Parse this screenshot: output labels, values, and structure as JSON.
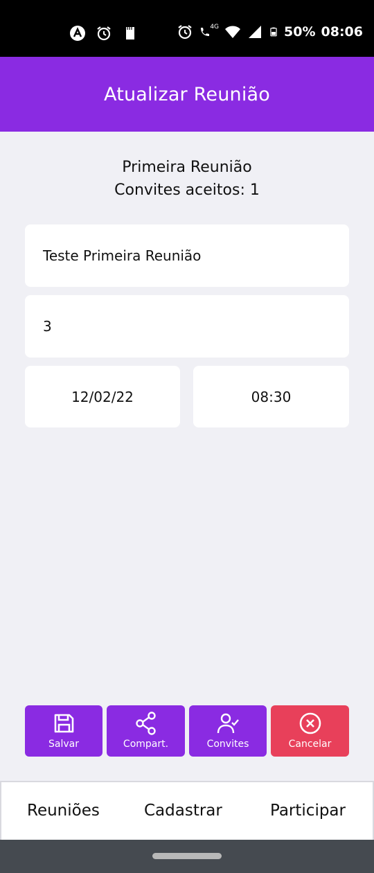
{
  "status_bar": {
    "left_icons": [
      "app-notification-icon",
      "alarm-icon",
      "sd-card-icon"
    ],
    "right_icons": [
      "alarm-icon",
      "wifi-calling-icon",
      "wifi-icon",
      "signal-icon",
      "battery-icon"
    ],
    "network_label": "4G",
    "battery": "50%",
    "time": "08:06"
  },
  "header": {
    "title": "Atualizar Reunião"
  },
  "meeting": {
    "title": "Primeira Reunião",
    "accepted": "Convites aceitos: 1"
  },
  "form": {
    "name_value": "Teste Primeira Reunião",
    "number_value": "3",
    "date_value": "12/02/22",
    "time_value": "08:30"
  },
  "actions": {
    "save": "Salvar",
    "share": "Compart.",
    "invites": "Convites",
    "cancel": "Cancelar"
  },
  "bottom_nav": {
    "meetings": "Reuniões",
    "register": "Cadastrar",
    "participate": "Participar"
  },
  "colors": {
    "primary": "#8a2be2",
    "cancel": "#e8405a",
    "background": "#f0f0f5"
  }
}
